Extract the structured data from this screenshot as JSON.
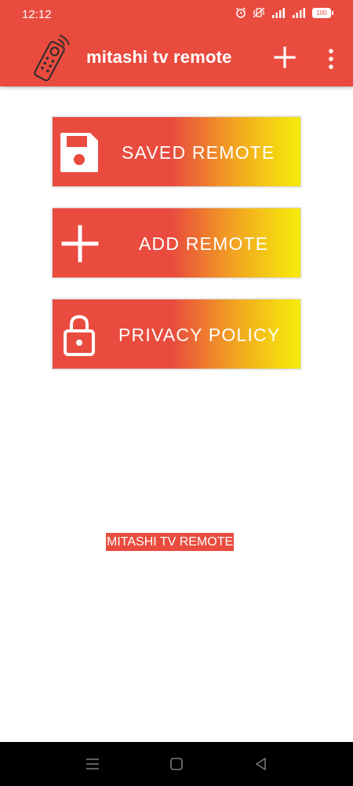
{
  "status_bar": {
    "time": "12:12",
    "battery": "100",
    "icons": [
      "alarm-icon",
      "vibrate-icon",
      "signal-icon",
      "signal-icon",
      "battery-icon"
    ]
  },
  "app_bar": {
    "title": "mitashi tv remote",
    "icon": "remote-control-icon",
    "actions": [
      "add-icon",
      "more-vert-icon"
    ],
    "color": "#e94b3f"
  },
  "menu_buttons": [
    {
      "label": "SAVED REMOTE",
      "icon": "floppy-disk-icon"
    },
    {
      "label": "ADD REMOTE",
      "icon": "plus-icon"
    },
    {
      "label": "PRIVACY POLICY",
      "icon": "lock-icon"
    }
  ],
  "gradient_colors": [
    "#e94b3f",
    "#f2a91f",
    "#f6ec0a"
  ],
  "footer": {
    "label": "MITASHI TV REMOTE"
  },
  "nav_bar": {
    "buttons": [
      "menu-icon",
      "home-square-icon",
      "back-triangle-icon"
    ]
  }
}
